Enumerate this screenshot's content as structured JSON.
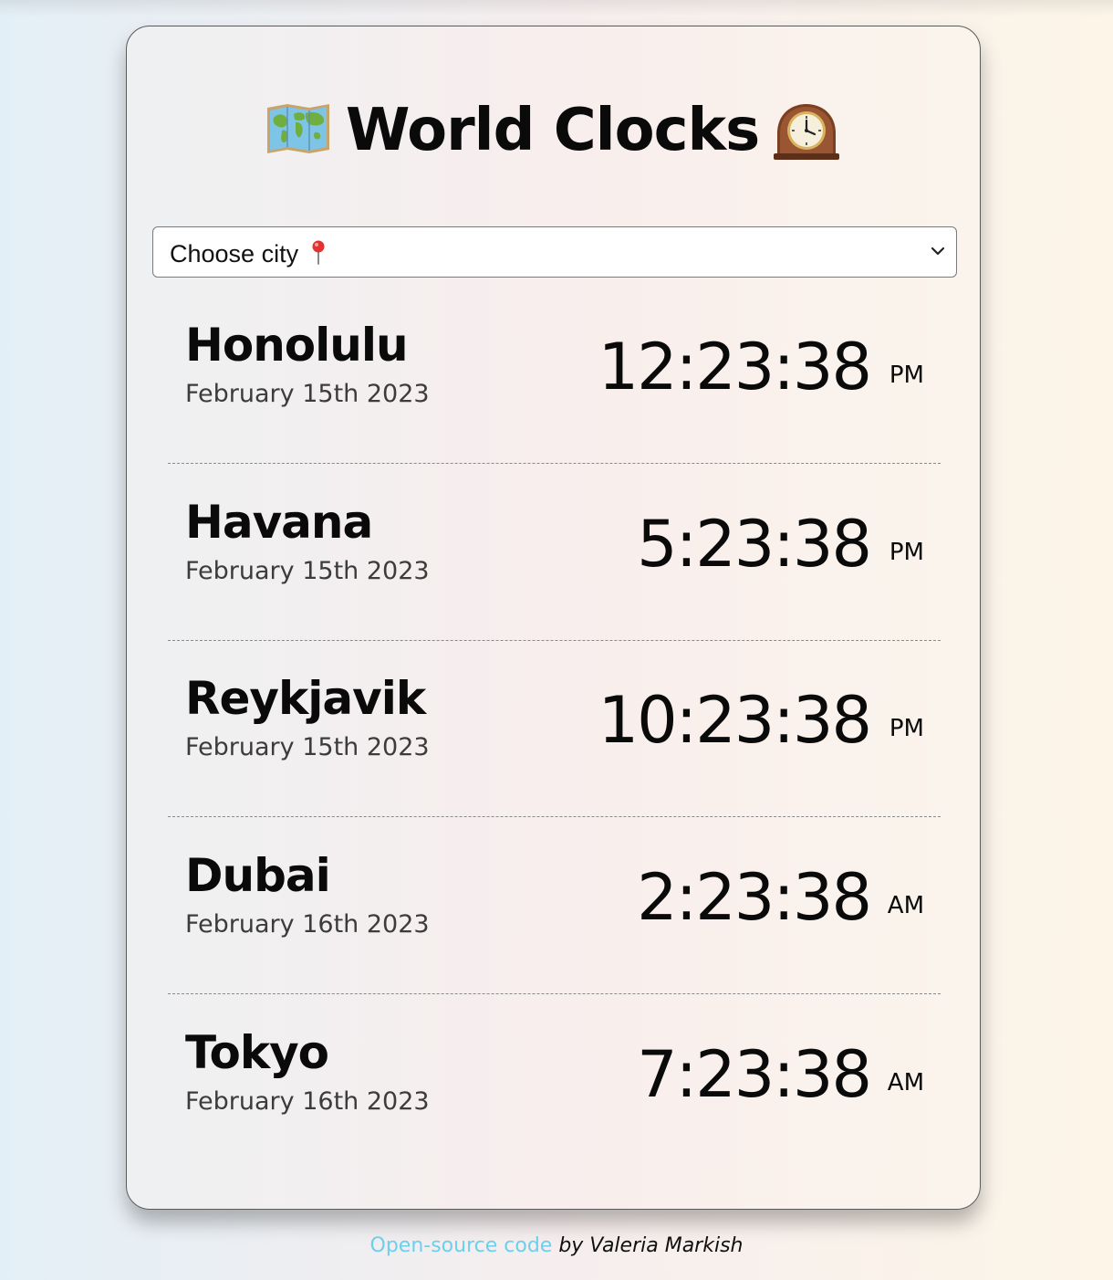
{
  "title": {
    "text": "World Clocks",
    "left_icon": "world-map-icon",
    "right_icon": "mantelpiece-clock-icon"
  },
  "city_select": {
    "selected_label": "Choose city",
    "icon": "round-pushpin-icon"
  },
  "cities": [
    {
      "name": "Honolulu",
      "date": "February 15th 2023",
      "time": "12:23:38",
      "ampm": "PM"
    },
    {
      "name": "Havana",
      "date": "February 15th 2023",
      "time": "5:23:38",
      "ampm": "PM"
    },
    {
      "name": "Reykjavik",
      "date": "February 15th 2023",
      "time": "10:23:38",
      "ampm": "PM"
    },
    {
      "name": "Dubai",
      "date": "February 16th 2023",
      "time": "2:23:38",
      "ampm": "AM"
    },
    {
      "name": "Tokyo",
      "date": "February 16th 2023",
      "time": "7:23:38",
      "ampm": "AM"
    }
  ],
  "footer": {
    "link_text": "Open-source code",
    "credit_text": "by Valeria Markish"
  },
  "colors": {
    "link": "#6ccfee",
    "text": "#0a0a0a",
    "date_text": "#3c3c3c"
  }
}
